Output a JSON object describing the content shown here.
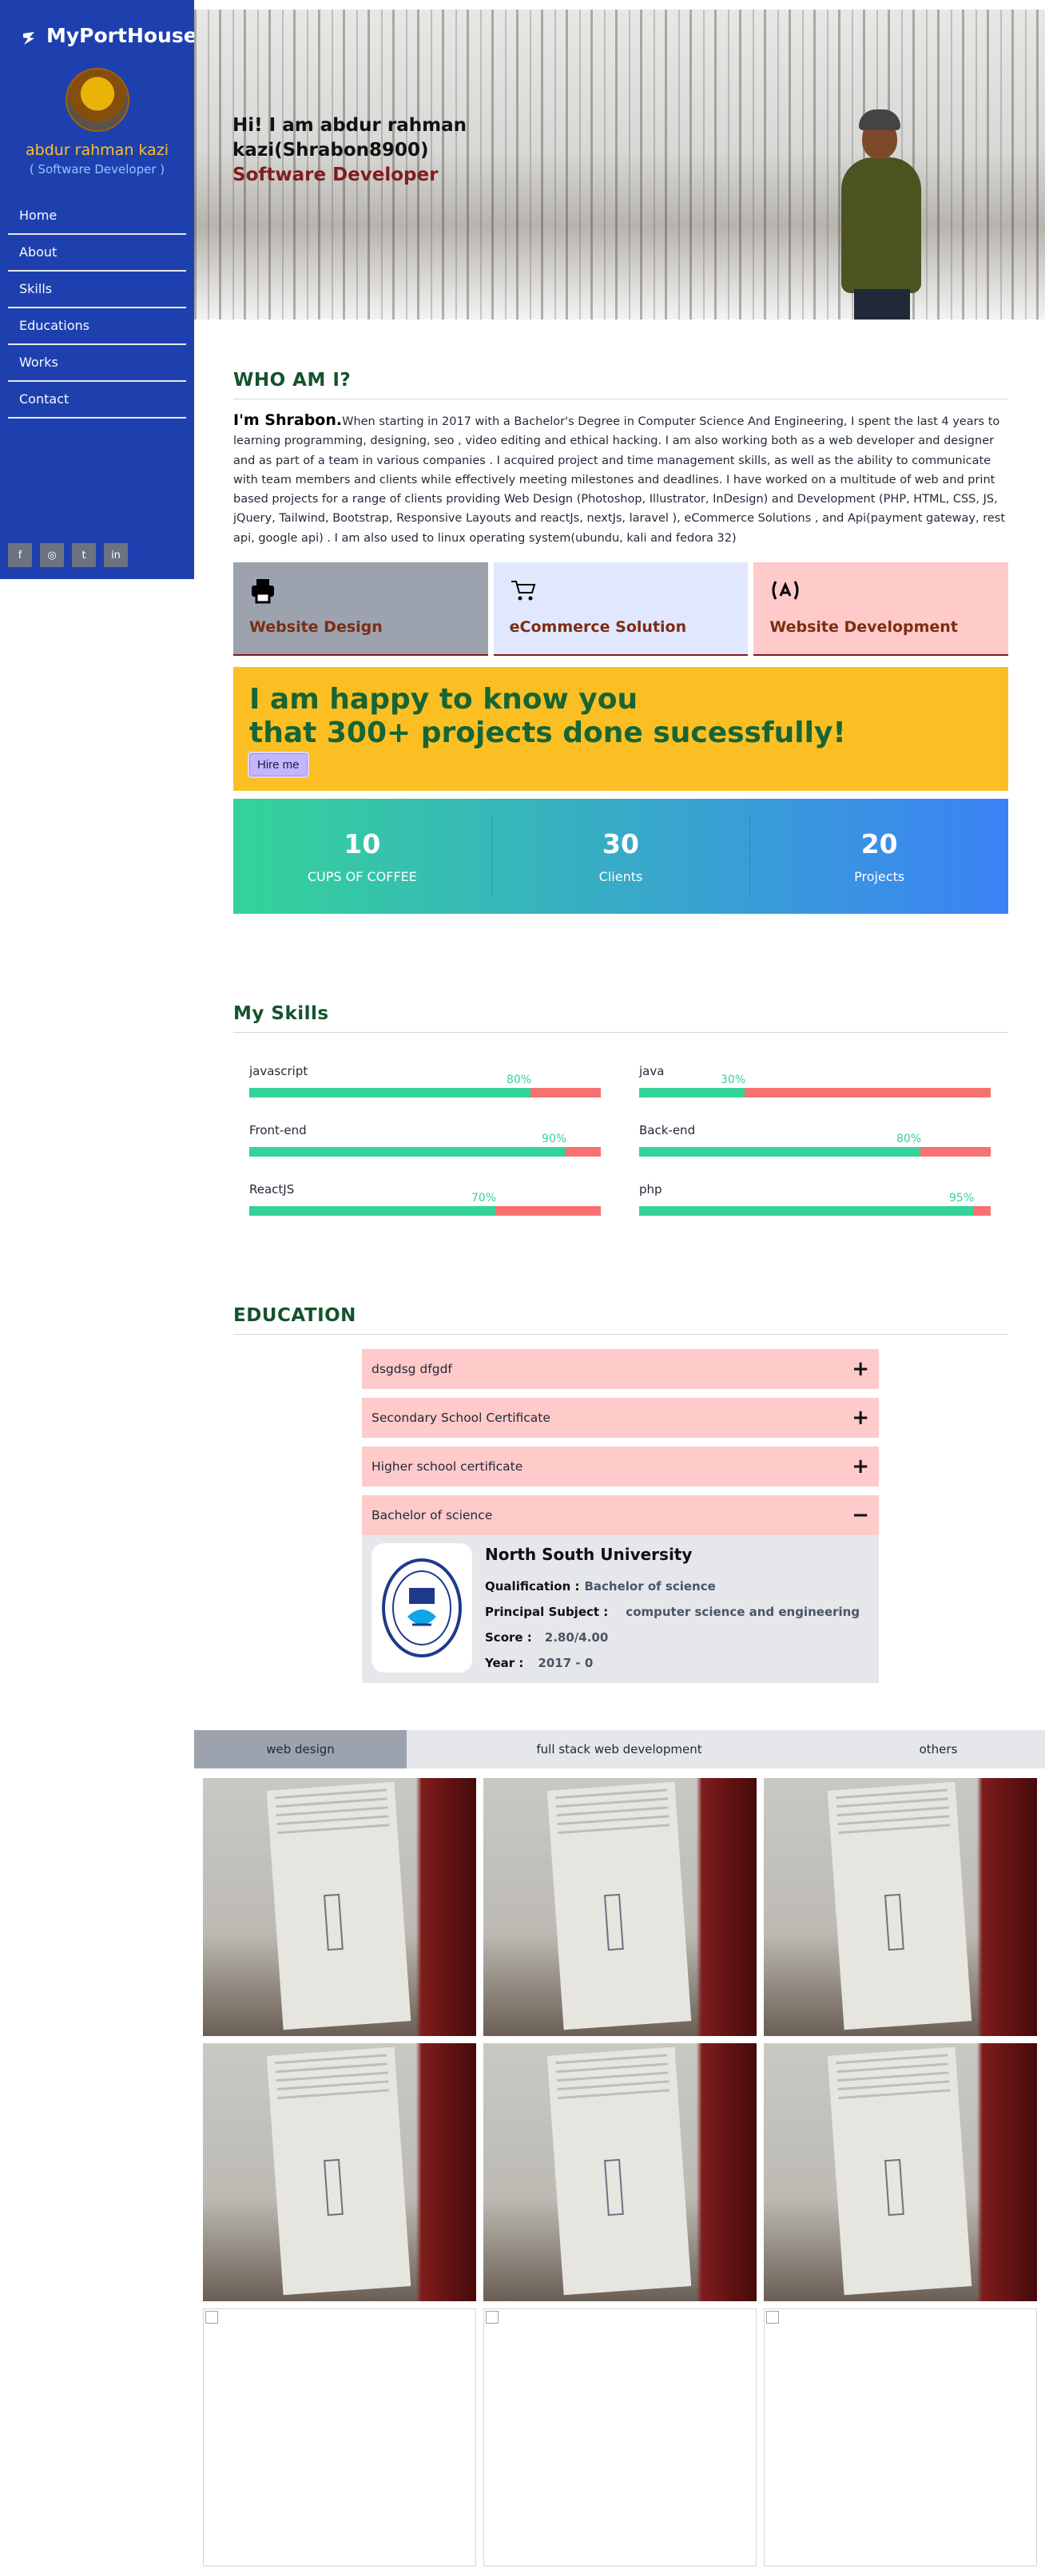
{
  "sidebar": {
    "brand": "MyPortHouse",
    "name": "abdur rahman kazi",
    "role": "( Software Developer )",
    "nav": [
      "Home",
      "About",
      "Skills",
      "Educations",
      "Works",
      "Contact"
    ],
    "social": [
      "facebook-icon",
      "instagram-icon",
      "twitter-icon",
      "linkedin-icon"
    ]
  },
  "hero": {
    "greeting": "Hi! I am abdur rahman kazi(Shrabon8900)",
    "role": "Software Developer"
  },
  "about": {
    "title": "WHO AM I?",
    "lead": "I'm Shrabon.",
    "text": "When starting in 2017 with a Bachelor's Degree in Computer Science And Engineering, I spent the last 4 years to learning programming, designing, seo , video editing and ethical hacking. I am also working both as a web developer and designer and as part of a team in various companies . I acquired project and time management skills, as well as the ability to communicate with team members and clients while effectively meeting milestones and deadlines. I have worked on a multitude of web and print based projects for a range of clients providing Web Design (Photoshop, Illustrator, InDesign) and Development (PHP, HTML, CSS, JS, jQuery, Tailwind, Bootstrap, Responsive Layouts and reactJs, nextJs, laravel ), eCommerce Solutions , and Api(payment gateway, rest api, google api) . I am also used to linux operating system(ubundu, kali and fedora 32)"
  },
  "services": [
    {
      "title": "Website Design",
      "icon": "printer-icon",
      "bg": "#9ca3af"
    },
    {
      "title": "eCommerce Solution",
      "icon": "cart-icon",
      "bg": "#e0e7ff"
    },
    {
      "title": "Website Development",
      "icon": "code-icon",
      "bg": "#fecaca"
    }
  ],
  "banner": {
    "line1": "I am happy to know you",
    "line2": "that 300+ projects done sucessfully!",
    "button": "Hire me"
  },
  "stats": [
    {
      "value": "10",
      "label": "CUPS OF COFFEE"
    },
    {
      "value": "30",
      "label": "Clients"
    },
    {
      "value": "20",
      "label": "Projects"
    }
  ],
  "skills": {
    "title": "My Skills",
    "items": [
      {
        "name": "javascript",
        "percent": 80,
        "label": "80%"
      },
      {
        "name": "java",
        "percent": 30,
        "label": "30%"
      },
      {
        "name": "Front-end",
        "percent": 90,
        "label": "90%"
      },
      {
        "name": "Back-end",
        "percent": 80,
        "label": "80%"
      },
      {
        "name": "ReactJS",
        "percent": 70,
        "label": "70%"
      },
      {
        "name": "php",
        "percent": 95,
        "label": "95%"
      }
    ]
  },
  "education": {
    "title": "EDUCATION",
    "items": [
      "dsgdsg dfgdf",
      "Secondary School Certificate",
      "Higher school certificate",
      "Bachelor of science"
    ],
    "expanded": {
      "university": "North South University",
      "qualification_label": "Qualification :",
      "qualification": "Bachelor of science",
      "subject_label": "Principal Subject :",
      "subject": "computer science and engineering",
      "score_label": "Score :",
      "score": "2.80/4.00",
      "year_label": "Year :",
      "year": "2017 - 0"
    }
  },
  "works": {
    "tabs": [
      "web design",
      "full stack web development",
      "others"
    ],
    "active_tab": 0
  },
  "colors": {
    "sidebar": "#1e40af",
    "accent_green": "#34d399",
    "accent_red": "#f87171",
    "banner": "#fbbf24"
  }
}
